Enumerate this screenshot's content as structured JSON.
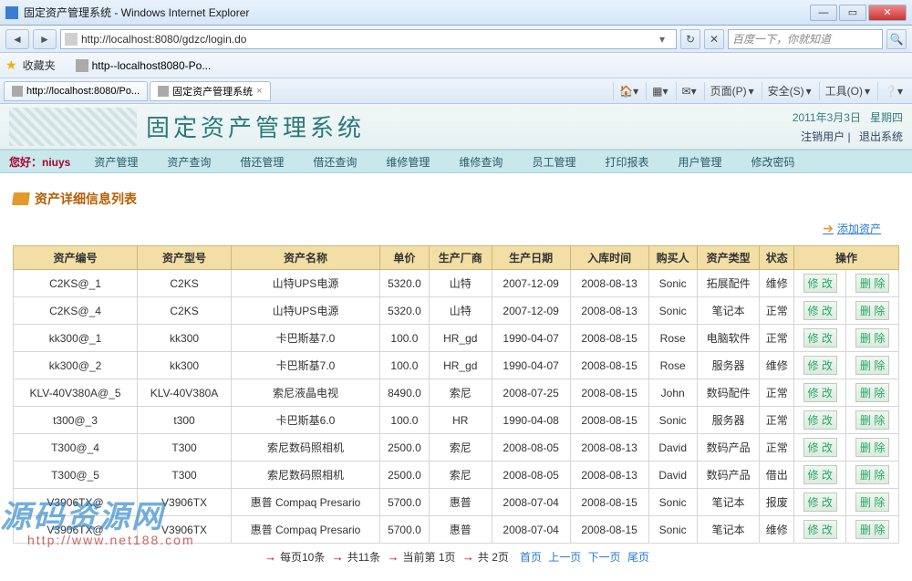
{
  "browser": {
    "title": "固定资产管理系统 - Windows Internet Explorer",
    "url": "http://localhost:8080/gdzc/login.do",
    "search_placeholder": "百度一下，你就知道",
    "fav_label": "收藏夹",
    "fav_item": "http--localhost8080-Po...",
    "tabs": [
      {
        "label": "http://localhost:8080/Po..."
      },
      {
        "label": "固定资产管理系统"
      }
    ],
    "tools": {
      "page": "页面(P)",
      "safety": "安全(S)",
      "tools": "工具(O)"
    }
  },
  "banner": {
    "title": "固定资产管理系统",
    "date": "2011年3月3日",
    "day": "星期四",
    "logout_user": "注销用户",
    "exit_system": "退出系统"
  },
  "menu": {
    "greet": "您好：niuys",
    "items": [
      "资产管理",
      "资产查询",
      "借还管理",
      "借还查询",
      "维修管理",
      "维修查询",
      "员工管理",
      "打印报表",
      "用户管理",
      "修改密码"
    ]
  },
  "section": {
    "title": "资产详细信息列表",
    "add_label": "添加资产"
  },
  "table": {
    "headers": [
      "资产编号",
      "资产型号",
      "资产名称",
      "单价",
      "生产厂商",
      "生产日期",
      "入库时间",
      "购买人",
      "资产类型",
      "状态",
      "操作"
    ],
    "op_edit": "修 改",
    "op_del": "删 除",
    "rows": [
      [
        "C2KS@_1",
        "C2KS",
        "山特UPS电源",
        "5320.0",
        "山特",
        "2007-12-09",
        "2008-08-13",
        "Sonic",
        "拓展配件",
        "维修"
      ],
      [
        "C2KS@_4",
        "C2KS",
        "山特UPS电源",
        "5320.0",
        "山特",
        "2007-12-09",
        "2008-08-13",
        "Sonic",
        "笔记本",
        "正常"
      ],
      [
        "kk300@_1",
        "kk300",
        "卡巴斯基7.0",
        "100.0",
        "HR_gd",
        "1990-04-07",
        "2008-08-15",
        "Rose",
        "电脑软件",
        "正常"
      ],
      [
        "kk300@_2",
        "kk300",
        "卡巴斯基7.0",
        "100.0",
        "HR_gd",
        "1990-04-07",
        "2008-08-15",
        "Rose",
        "服务器",
        "维修"
      ],
      [
        "KLV-40V380A@_5",
        "KLV-40V380A",
        "索尼液晶电视",
        "8490.0",
        "索尼",
        "2008-07-25",
        "2008-08-15",
        "John",
        "数码配件",
        "正常"
      ],
      [
        "t300@_3",
        "t300",
        "卡巴斯基6.0",
        "100.0",
        "HR",
        "1990-04-08",
        "2008-08-15",
        "Sonic",
        "服务器",
        "正常"
      ],
      [
        "T300@_4",
        "T300",
        "索尼数码照相机",
        "2500.0",
        "索尼",
        "2008-08-05",
        "2008-08-13",
        "David",
        "数码产品",
        "正常"
      ],
      [
        "T300@_5",
        "T300",
        "索尼数码照相机",
        "2500.0",
        "索尼",
        "2008-08-05",
        "2008-08-13",
        "David",
        "数码产品",
        "借出"
      ],
      [
        "V3906TX@",
        "V3906TX",
        "惠普 Compaq Presario",
        "5700.0",
        "惠普",
        "2008-07-04",
        "2008-08-15",
        "Sonic",
        "笔记本",
        "报废"
      ],
      [
        "V3906TX@",
        "V3906TX",
        "惠普 Compaq Presario",
        "5700.0",
        "惠普",
        "2008-07-04",
        "2008-08-15",
        "Sonic",
        "笔记本",
        "维修"
      ]
    ]
  },
  "pager": {
    "per_page": "每页10条",
    "total_rows": "共11条",
    "current": "当前第 1页",
    "total_pages": "共 2页",
    "first": "首页",
    "prev": "上一页",
    "next": "下一页",
    "last": "尾页"
  },
  "watermark": {
    "text": "源码资源网",
    "url": "http://www.net188.com"
  }
}
